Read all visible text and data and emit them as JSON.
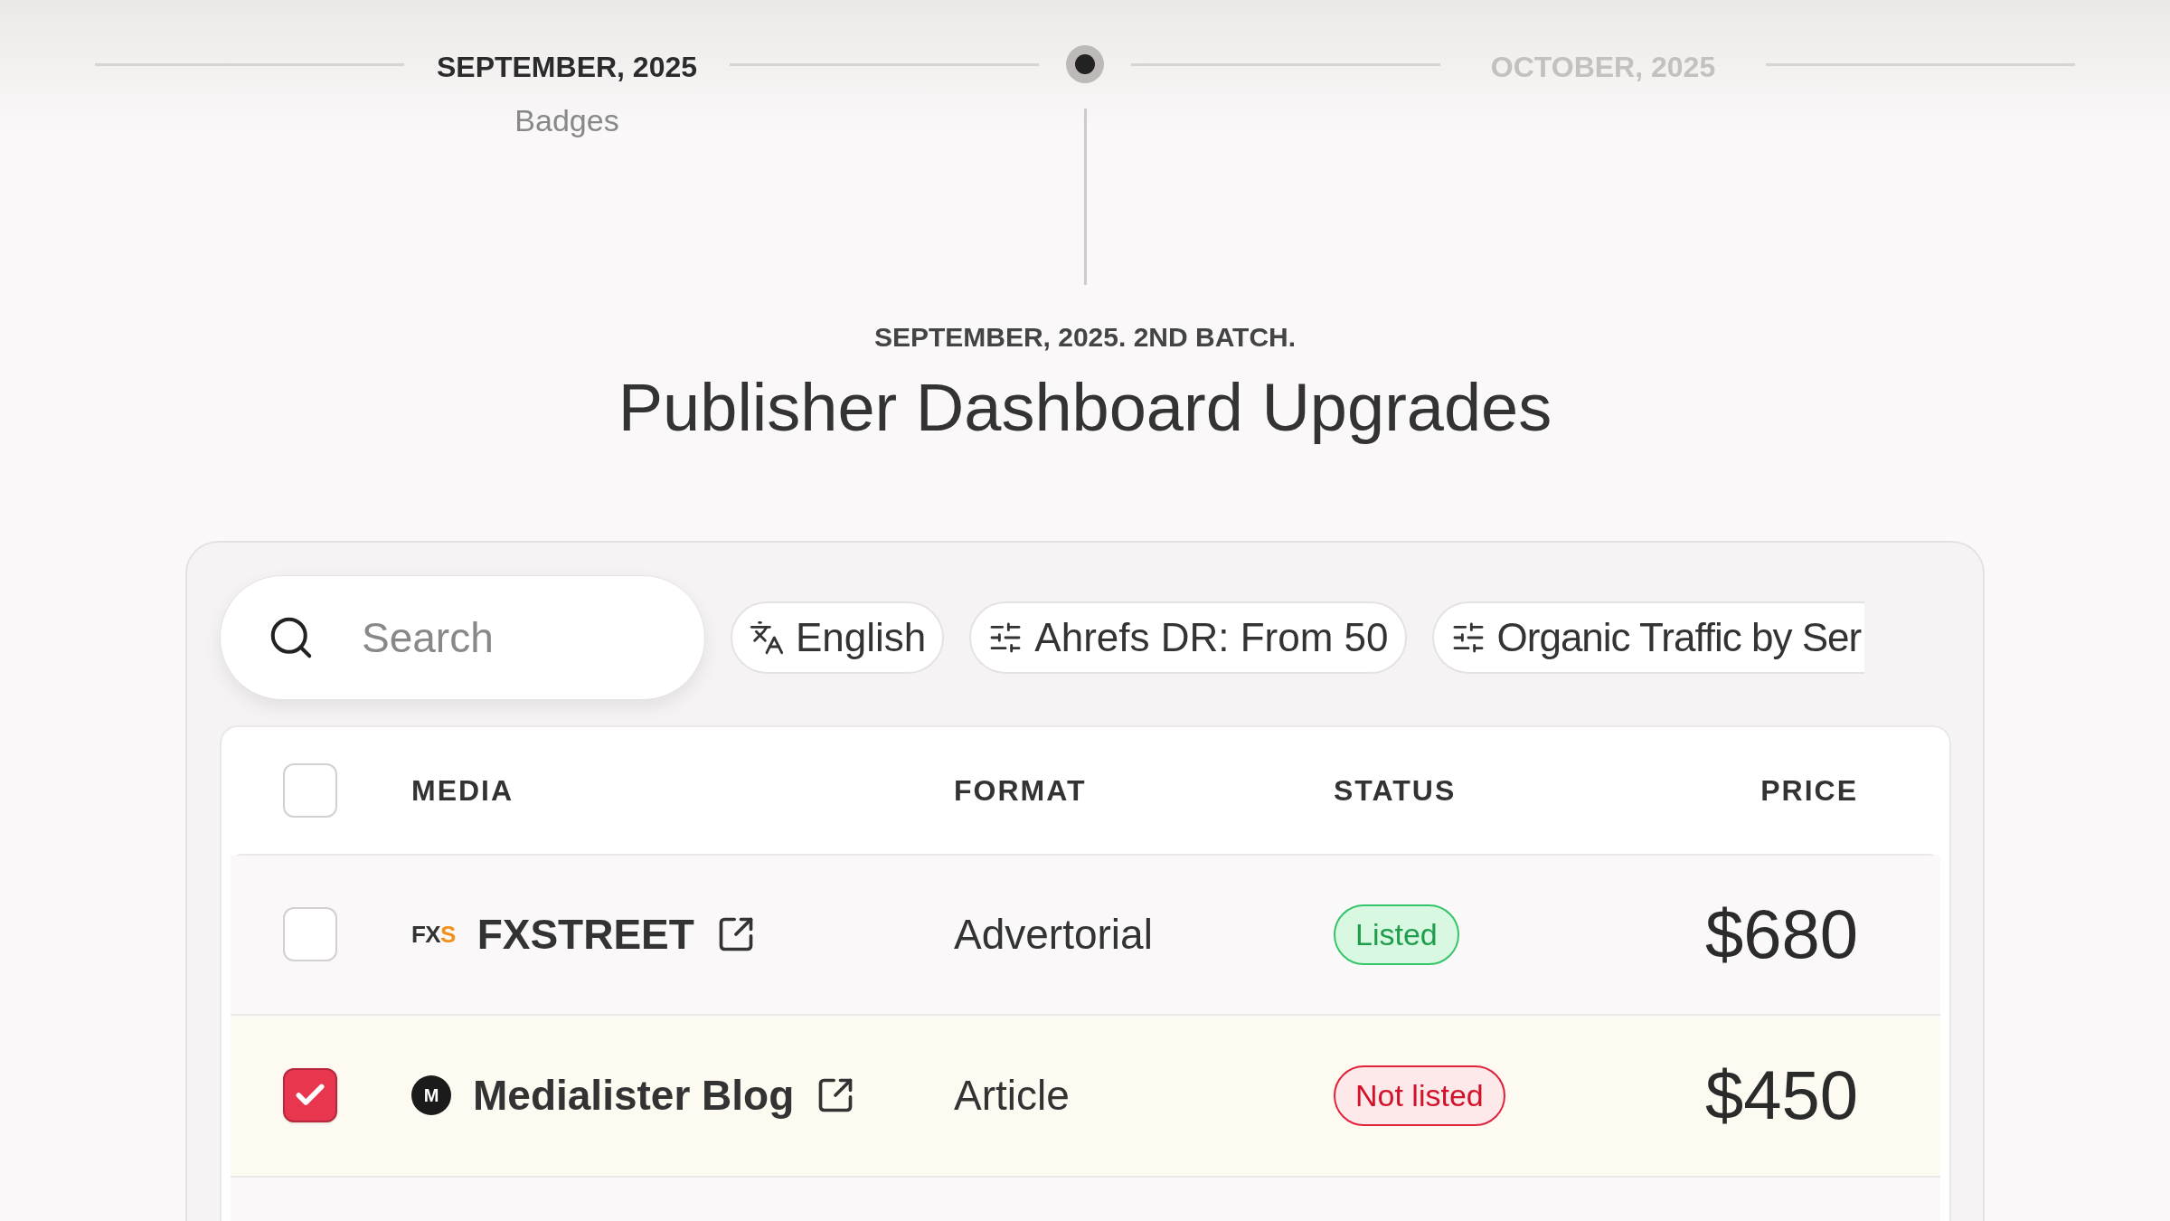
{
  "timeline": {
    "items": [
      {
        "date": "SEPTEMBER, 2025",
        "subtitle": "Badges",
        "selected": true
      },
      {
        "date": "OCTOBER, 2025",
        "selected": false
      }
    ]
  },
  "release": {
    "eyebrow": "SEPTEMBER, 2025. 2ND BATCH.",
    "title": "Publisher Dashboard Upgrades"
  },
  "search": {
    "placeholder": "Search"
  },
  "filters": [
    {
      "kind": "language",
      "label": "English"
    },
    {
      "kind": "filter",
      "label": "Ahrefs DR: From 50"
    },
    {
      "kind": "filter",
      "label": "Organic Traffic by Ser"
    }
  ],
  "table": {
    "all_checked": false,
    "columns": [
      "MEDIA",
      "FORMAT",
      "STATUS",
      "PRICE"
    ],
    "rows": [
      {
        "checked": false,
        "logo": {
          "kind": "wordmark",
          "text": "FXS"
        },
        "name": "FXSTREET",
        "format": "Advertorial",
        "status": {
          "kind": "listed",
          "label": "Listed"
        },
        "price": "$680"
      },
      {
        "checked": true,
        "logo": {
          "kind": "circle",
          "text": "M"
        },
        "name": "Medialister Blog",
        "format": "Article",
        "status": {
          "kind": "not_listed",
          "label": "Not listed"
        },
        "price": "$450"
      }
    ]
  }
}
